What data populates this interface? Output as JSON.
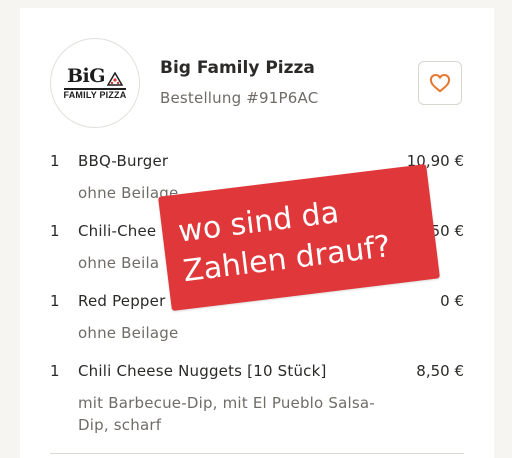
{
  "restaurant": {
    "logo_big": "BiG",
    "logo_sub": "FAMILY PIZZA",
    "name": "Big Family Pizza",
    "order_label": "Bestellung #91P6AC",
    "favorite_icon": "heart-icon"
  },
  "items": [
    {
      "qty": "1",
      "name": "BBQ-Burger",
      "price": "10,90 €",
      "desc": "ohne Beilage"
    },
    {
      "qty": "1",
      "name": "Chili-Chee",
      "price": "50 €",
      "desc": "ohne Beila"
    },
    {
      "qty": "1",
      "name": "Red Pepper",
      "price": "0 €",
      "desc": "ohne Beilage"
    },
    {
      "qty": "1",
      "name": "Chili Cheese Nuggets [10 Stück]",
      "price": "8,50 €",
      "desc": "mit Barbecue-Dip, mit El Pueblo Salsa-Dip, scharf"
    }
  ],
  "sticker": {
    "line1": "wo sind da",
    "line2": "Zahlen drauf?"
  },
  "colors": {
    "accent": "#e6772e",
    "sticker": "#e0373a"
  }
}
